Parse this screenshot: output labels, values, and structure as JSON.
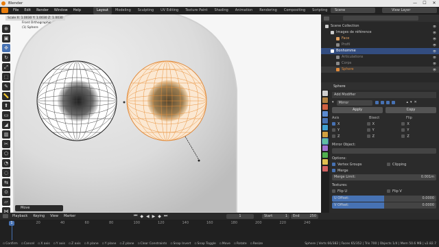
{
  "window": {
    "title": "Blender",
    "min": "—",
    "max": "☐",
    "close": "✕"
  },
  "menu": [
    "File",
    "Edit",
    "Render",
    "Window",
    "Help"
  ],
  "workspaces": [
    "Layout",
    "Modeling",
    "Sculpting",
    "UV Editing",
    "Texture Paint",
    "Shading",
    "Animation",
    "Rendering",
    "Compositing",
    "Scripting"
  ],
  "active_workspace": "Layout",
  "scene": {
    "label": "Scene",
    "view_layer": "View Layer"
  },
  "viewport": {
    "scale": "Scale X: 1.0030  Y: 1.0030  Z: 1.0030",
    "view": "Front Orthographic",
    "object": "(1) Sphere",
    "toolbar_icons": [
      "cursor-icon",
      "select-box-icon",
      "move-icon",
      "rotate-icon",
      "scale-icon",
      "transform-icon",
      "annotate-icon",
      "measure-icon",
      "extrude-icon",
      "inset-icon",
      "bevel-icon",
      "loop-cut-icon",
      "knife-icon",
      "poly-build-icon",
      "spin-icon",
      "smooth-icon",
      "edge-slide-icon",
      "shrink-icon",
      "shear-icon",
      "rip-icon"
    ],
    "op_panel": "Move"
  },
  "outliner": {
    "items": [
      {
        "name": "Scene Collection",
        "level": 0,
        "color": "#cccccc"
      },
      {
        "name": "Images de référence",
        "level": 1,
        "color": "#cccccc"
      },
      {
        "name": "Face",
        "level": 2,
        "color": "#e0a060"
      },
      {
        "name": "Profil",
        "level": 2,
        "color": "#8a8a8a"
      },
      {
        "name": "Bonhomme",
        "level": 1,
        "color": "#ffffff",
        "selected": true
      },
      {
        "name": "Articulations",
        "level": 2,
        "color": "#8a8a8a"
      },
      {
        "name": "Corps",
        "level": 2,
        "color": "#8a8a8a"
      },
      {
        "name": "Sphere",
        "level": 2,
        "color": "#e08a3c",
        "active": true
      }
    ]
  },
  "properties": {
    "object": "Sphere",
    "add_modifier": "Add Modifier",
    "modifier_name": "Mirror",
    "apply": "Apply",
    "copy": "Copy",
    "axis_header": "Axis",
    "bisect_header": "Bisect",
    "flip_header": "Flip",
    "axes": [
      "X",
      "Y",
      "Z"
    ],
    "mirror_object": "Mirror Object:",
    "options": "Options:",
    "vertex_groups": "Vertex Groups",
    "clipping": "Clipping",
    "merge": "Merge",
    "merge_limit_label": "Merge Limit:",
    "merge_limit_value": "0.001m",
    "textures": "Textures:",
    "flip_u": "Flip U",
    "flip_v": "Flip V",
    "u_offset_label": "U Offset:",
    "u_offset_value": "0.0000",
    "v_offset_label": "V Offset:",
    "v_offset_value": "0.0000"
  },
  "timeline": {
    "menus": [
      "Playback",
      "Keying",
      "View",
      "Marker"
    ],
    "current_frame": "1",
    "start_label": "Start",
    "start": "1",
    "end_label": "End",
    "end": "250",
    "ticks": [
      "0",
      "20",
      "40",
      "60",
      "80",
      "100",
      "120",
      "140",
      "160",
      "180",
      "200",
      "220",
      "240"
    ]
  },
  "status": {
    "items": [
      "Confirm",
      "Cancel",
      "X axis",
      "Y axis",
      "Z axis",
      "X plane",
      "Y plane",
      "Z plane",
      "Clear Constraints",
      "Snap Invert",
      "Snap Toggle",
      "Move",
      "Rotate",
      "Resize"
    ],
    "right": "Sphere | Verts 66/382 | Faces 65/352 | Tris 700 | Objects 1/4 | Mem 50.6 MB | v2.82.7"
  },
  "colors": {
    "accent": "#4772b3",
    "selected_orange": "#f0a040",
    "bg": "#2b2b2b"
  }
}
